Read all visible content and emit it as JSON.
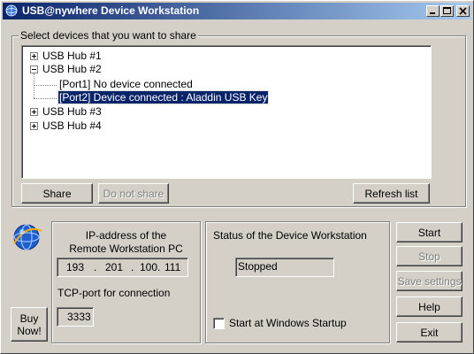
{
  "window": {
    "title": "USB@nywhere Device Workstation"
  },
  "devices_group": {
    "legend": "Select devices that you want to share",
    "tree": [
      {
        "label": "USB Hub #1",
        "expanded": false
      },
      {
        "label": "USB Hub #2",
        "expanded": true,
        "children": [
          {
            "label": "[Port1] No device connected",
            "selected": false
          },
          {
            "label": "[Port2] Device connected :  Aladdin USB Key",
            "selected": true
          }
        ]
      },
      {
        "label": "USB Hub #3",
        "expanded": false
      },
      {
        "label": "USB Hub #4",
        "expanded": false
      }
    ],
    "share_label": "Share",
    "do_not_share_label": "Do not share",
    "refresh_label": "Refresh list"
  },
  "ip_panel": {
    "title_line1": "IP-address of the",
    "title_line2": "Remote Workstation PC",
    "ip": [
      "193",
      "201",
      "100",
      "111"
    ],
    "dot": ".",
    "tcp_label": "TCP-port for connection",
    "port": "3333"
  },
  "status_panel": {
    "title": "Status of the Device Workstation",
    "status": "Stopped",
    "startup_label": "Start at Windows Startup",
    "startup_checked": false
  },
  "side_buttons": {
    "start": "Start",
    "stop": "Stop",
    "save": "Save settings",
    "help": "Help",
    "exit": "Exit"
  },
  "buy": {
    "line1": "Buy",
    "line2": "Now!"
  },
  "colors": {
    "face": "#d4d0c8",
    "title_start": "#0a246a",
    "title_end": "#a6caf0",
    "selection": "#0a246a"
  }
}
